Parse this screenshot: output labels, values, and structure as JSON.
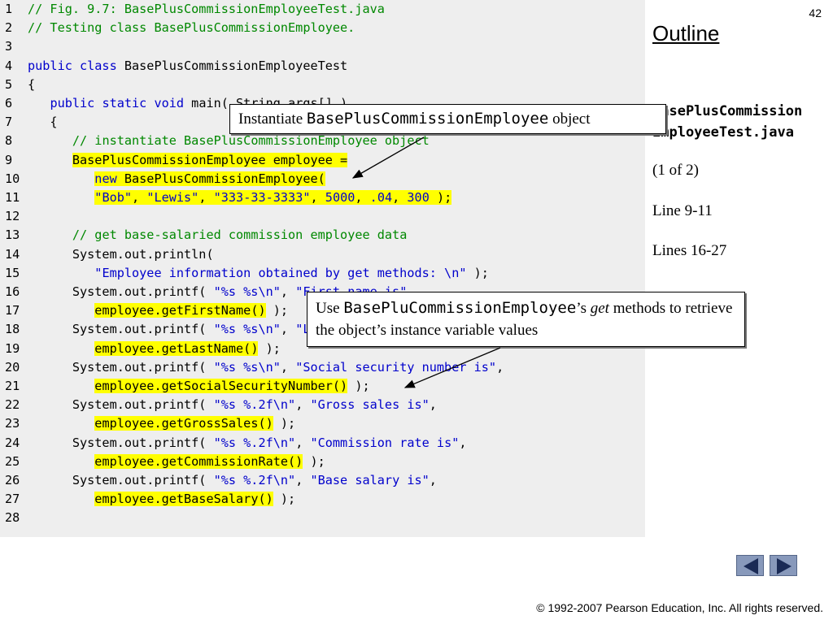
{
  "slide": {
    "page_number": "42",
    "outline_heading": "Outline",
    "file_name_line1": "BasePlusCommission",
    "file_name_line2": "EmployeeTest.java",
    "part": "(1 of 2)",
    "ref1": "Line 9-11",
    "ref2": "Lines 16-27",
    "copyright": "© 1992-2007 Pearson Education, Inc.  All rights reserved."
  },
  "callouts": {
    "c1_pre": "Instantiate ",
    "c1_mono": "BasePlusCommissionEmployee",
    "c1_post": " object",
    "c2_pre": "Use ",
    "c2_mono": "BasePluCommissionEmployee",
    "c2_mid": "’s ",
    "c2_em": "get",
    "c2_post": " methods to retrieve the object’s instance variable values"
  },
  "nav": {
    "prev_icon": "left-triangle-icon",
    "next_icon": "right-triangle-icon"
  },
  "code_lines": [
    {
      "n": "1",
      "segs": [
        {
          "t": "// Fig. 9.7: BasePlusCommissionEmployeeTest.java",
          "c": "cm"
        }
      ]
    },
    {
      "n": "2",
      "segs": [
        {
          "t": "// Testing class BasePlusCommissionEmployee.",
          "c": "cm"
        }
      ]
    },
    {
      "n": "3",
      "segs": []
    },
    {
      "n": "4",
      "segs": [
        {
          "t": "public class",
          "c": "kw"
        },
        {
          "t": " BasePlusCommissionEmployeeTest",
          "c": ""
        }
      ]
    },
    {
      "n": "5",
      "segs": [
        {
          "t": "{",
          "c": ""
        }
      ]
    },
    {
      "n": "6",
      "segs": [
        {
          "t": "   ",
          "c": ""
        },
        {
          "t": "public static void",
          "c": "kw"
        },
        {
          "t": " main( String args[] )",
          "c": ""
        }
      ]
    },
    {
      "n": "7",
      "segs": [
        {
          "t": "   {",
          "c": ""
        }
      ]
    },
    {
      "n": "8",
      "segs": [
        {
          "t": "      ",
          "c": ""
        },
        {
          "t": "// instantiate BasePlusCommissionEmployee object",
          "c": "cm"
        }
      ]
    },
    {
      "n": "9",
      "segs": [
        {
          "t": "      ",
          "c": ""
        },
        {
          "t": "BasePlusCommissionEmployee employee =",
          "c": "hl"
        }
      ]
    },
    {
      "n": "10",
      "segs": [
        {
          "t": "         ",
          "c": ""
        },
        {
          "t": "new",
          "c": "kw hl"
        },
        {
          "t": " BasePlusCommissionEmployee(",
          "c": "hl"
        }
      ]
    },
    {
      "n": "11",
      "segs": [
        {
          "t": "         ",
          "c": ""
        },
        {
          "t": "\"Bob\"",
          "c": "str hl"
        },
        {
          "t": ", ",
          "c": "hl"
        },
        {
          "t": "\"Lewis\"",
          "c": "str hl"
        },
        {
          "t": ", ",
          "c": "hl"
        },
        {
          "t": "\"333-33-3333\"",
          "c": "str hl"
        },
        {
          "t": ", ",
          "c": "hl"
        },
        {
          "t": "5000",
          "c": "num hl"
        },
        {
          "t": ", ",
          "c": "hl"
        },
        {
          "t": ".04",
          "c": "num hl"
        },
        {
          "t": ", ",
          "c": "hl"
        },
        {
          "t": "300",
          "c": "num hl"
        },
        {
          "t": " );",
          "c": "hl"
        }
      ]
    },
    {
      "n": "12",
      "segs": []
    },
    {
      "n": "13",
      "segs": [
        {
          "t": "      ",
          "c": ""
        },
        {
          "t": "// get base-salaried commission employee data",
          "c": "cm"
        }
      ]
    },
    {
      "n": "14",
      "segs": [
        {
          "t": "      System.out.println(",
          "c": ""
        }
      ]
    },
    {
      "n": "15",
      "segs": [
        {
          "t": "         ",
          "c": ""
        },
        {
          "t": "\"Employee information obtained by get methods: \\n\"",
          "c": "str"
        },
        {
          "t": " );",
          "c": ""
        }
      ]
    },
    {
      "n": "16",
      "segs": [
        {
          "t": "      System.out.printf( ",
          "c": ""
        },
        {
          "t": "\"%s %s\\n\"",
          "c": "str"
        },
        {
          "t": ", ",
          "c": ""
        },
        {
          "t": "\"First name is\"",
          "c": "str"
        },
        {
          "t": ",",
          "c": ""
        }
      ]
    },
    {
      "n": "17",
      "segs": [
        {
          "t": "         ",
          "c": ""
        },
        {
          "t": "employee.getFirstName()",
          "c": "hl"
        },
        {
          "t": " );",
          "c": ""
        }
      ]
    },
    {
      "n": "18",
      "segs": [
        {
          "t": "      System.out.printf( ",
          "c": ""
        },
        {
          "t": "\"%s %s\\n\"",
          "c": "str"
        },
        {
          "t": ", ",
          "c": ""
        },
        {
          "t": "\"Last name is\"",
          "c": "str"
        },
        {
          "t": ",",
          "c": ""
        }
      ]
    },
    {
      "n": "19",
      "segs": [
        {
          "t": "         ",
          "c": ""
        },
        {
          "t": "employee.getLastName()",
          "c": "hl"
        },
        {
          "t": " );",
          "c": ""
        }
      ]
    },
    {
      "n": "20",
      "segs": [
        {
          "t": "      System.out.printf( ",
          "c": ""
        },
        {
          "t": "\"%s %s\\n\"",
          "c": "str"
        },
        {
          "t": ", ",
          "c": ""
        },
        {
          "t": "\"Social security number is\"",
          "c": "str"
        },
        {
          "t": ",",
          "c": ""
        }
      ]
    },
    {
      "n": "21",
      "segs": [
        {
          "t": "         ",
          "c": ""
        },
        {
          "t": "employee.getSocialSecurityNumber()",
          "c": "hl"
        },
        {
          "t": " );",
          "c": ""
        }
      ]
    },
    {
      "n": "22",
      "segs": [
        {
          "t": "      System.out.printf( ",
          "c": ""
        },
        {
          "t": "\"%s %.2f\\n\"",
          "c": "str"
        },
        {
          "t": ", ",
          "c": ""
        },
        {
          "t": "\"Gross sales is\"",
          "c": "str"
        },
        {
          "t": ",",
          "c": ""
        }
      ]
    },
    {
      "n": "23",
      "segs": [
        {
          "t": "         ",
          "c": ""
        },
        {
          "t": "employee.getGrossSales()",
          "c": "hl"
        },
        {
          "t": " );",
          "c": ""
        }
      ]
    },
    {
      "n": "24",
      "segs": [
        {
          "t": "      System.out.printf( ",
          "c": ""
        },
        {
          "t": "\"%s %.2f\\n\"",
          "c": "str"
        },
        {
          "t": ", ",
          "c": ""
        },
        {
          "t": "\"Commission rate is\"",
          "c": "str"
        },
        {
          "t": ",",
          "c": ""
        }
      ]
    },
    {
      "n": "25",
      "segs": [
        {
          "t": "         ",
          "c": ""
        },
        {
          "t": "employee.getCommissionRate()",
          "c": "hl"
        },
        {
          "t": " );",
          "c": ""
        }
      ]
    },
    {
      "n": "26",
      "segs": [
        {
          "t": "      System.out.printf( ",
          "c": ""
        },
        {
          "t": "\"%s %.2f\\n\"",
          "c": "str"
        },
        {
          "t": ", ",
          "c": ""
        },
        {
          "t": "\"Base salary is\"",
          "c": "str"
        },
        {
          "t": ",",
          "c": ""
        }
      ]
    },
    {
      "n": "27",
      "segs": [
        {
          "t": "         ",
          "c": ""
        },
        {
          "t": "employee.getBaseSalary()",
          "c": "hl"
        },
        {
          "t": " );",
          "c": ""
        }
      ]
    },
    {
      "n": "28",
      "segs": []
    }
  ]
}
